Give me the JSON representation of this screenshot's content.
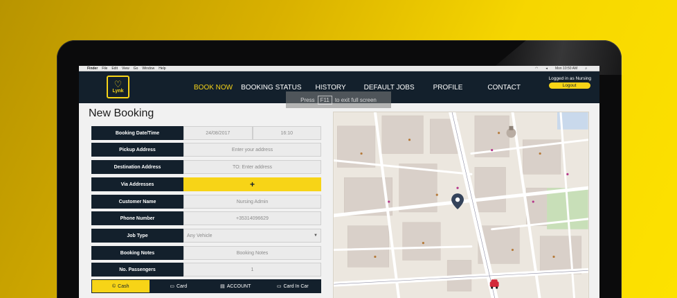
{
  "menubar": {
    "app": "Finder",
    "items": [
      "File",
      "Edit",
      "View",
      "Go",
      "Window",
      "Help"
    ],
    "clock": "Mon 10:50 AM"
  },
  "brand": {
    "logo_text": "Lynk"
  },
  "nav": {
    "items": [
      "BOOK NOW",
      "BOOKING STATUS",
      "HISTORY",
      "DEFAULT JOBS",
      "PROFILE",
      "CONTACT"
    ],
    "active_index": 0
  },
  "user": {
    "logged_in_text": "Logged in as Nursing",
    "logout_label": "Logout"
  },
  "overlay": {
    "prefix": "Press",
    "key": "F11",
    "suffix": "to exit full screen"
  },
  "form": {
    "title": "New Booking",
    "date_label": "Booking Date/Time",
    "date_value": "24/08/2017",
    "time_value": "16:10",
    "pickup_label": "Pickup Address",
    "pickup_placeholder": "Enter your address",
    "destination_label": "Destination Address",
    "destination_placeholder": "TO: Enter address",
    "via_label": "Via Addresses",
    "via_button": "+",
    "customer_label": "Customer Name",
    "customer_value": "Nursing Admin",
    "phone_label": "Phone Number",
    "phone_value": "+35314096629",
    "jobtype_label": "Job Type",
    "jobtype_value": "Any Vehicle",
    "notes_label": "Booking Notes",
    "notes_placeholder": "Booking Notes",
    "passengers_label": "No. Passengers",
    "passengers_value": "1"
  },
  "payment": {
    "options": [
      "Cash",
      "Card",
      "ACCOUNT",
      "Card In Car"
    ],
    "selected_index": 0
  },
  "colors": {
    "accent": "#f7d417",
    "navy": "#13202c"
  }
}
